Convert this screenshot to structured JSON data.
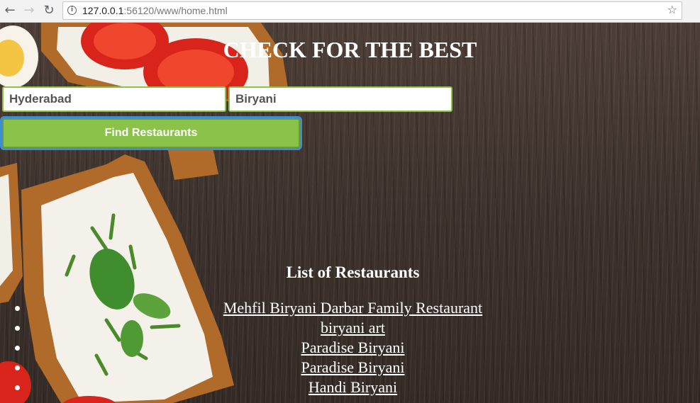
{
  "browser": {
    "back_icon": "←",
    "forward_icon": "→",
    "reload_icon": "↻",
    "info_icon": "i",
    "url_host": "127.0.0.1",
    "url_path": ":56120/www/home.html",
    "bookmark_icon": "☆"
  },
  "header": {
    "title": "CHECK FOR THE BEST"
  },
  "search": {
    "city_value": "Hyderabad",
    "dish_value": "Biryani",
    "button_label": "Find Restaurants"
  },
  "results": {
    "heading": "List of Restaurants",
    "items": [
      "Mehfil Biryani Darbar Family Restaurant",
      "biryani art",
      "Paradise Biryani",
      "Paradise Biryani",
      "Handi Biryani"
    ]
  },
  "colors": {
    "accent": "#8bc34a",
    "button_focus_ring": "#3d8fd1",
    "wood_background": "#3d322c"
  }
}
